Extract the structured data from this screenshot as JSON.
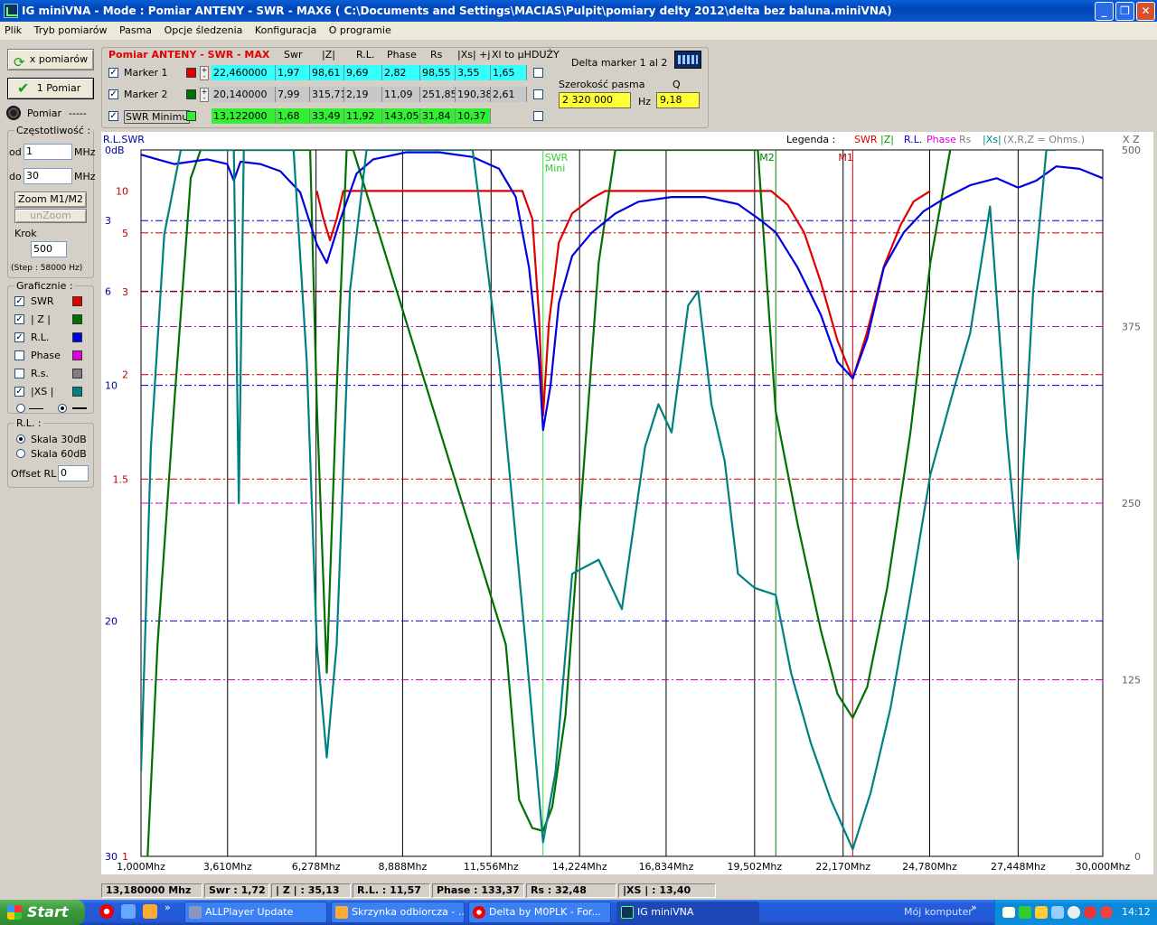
{
  "window": {
    "title": "IG miniVNA - Mode : Pomiar ANTENY - SWR     - MAX6 ( C:\\Documents and Settings\\MACIAS\\Pulpit\\pomiary delty 2012\\delta bez baluna.miniVNA)",
    "buttons": [
      "minimize",
      "maximize",
      "close"
    ]
  },
  "menu": [
    "Plik",
    "Tryb pomiarów",
    "Pasma",
    "Opcje śledzenia",
    "Konfiguracja",
    "O programie"
  ],
  "left": {
    "x_pomiarow": "x pomiarów",
    "one_pomiar": "1 Pomiar",
    "pomiar_label": "Pomiar",
    "pomiar_value": "-----",
    "freq_group": "Częstotliwość :",
    "od_label": "od",
    "od_value": "1",
    "do_label": "do",
    "do_value": "30",
    "mhz": "MHz",
    "zoom": "Zoom M1/M2",
    "unzoom": "unZoom",
    "krok_label": "Krok",
    "krok_value": "500",
    "step_text": "(Step : 58000 Hz)",
    "graf_group": "Graficznie :",
    "traces": [
      {
        "label": "SWR",
        "checked": true,
        "color": "#e00000"
      },
      {
        "label": "| Z |",
        "checked": true,
        "color": "#007000"
      },
      {
        "label": "R.L.",
        "checked": true,
        "color": "#0000e0"
      },
      {
        "label": "Phase",
        "checked": false,
        "color": "#e000e0"
      },
      {
        "label": "R.s.",
        "checked": false,
        "color": "#808080"
      },
      {
        "label": "|XS |",
        "checked": true,
        "color": "#008080"
      }
    ],
    "rl_group": "R.L. :",
    "skala30": "Skala 30dB",
    "skala60": "Skala 60dB",
    "offset_label": "Offset RL",
    "offset_value": "0"
  },
  "markers": {
    "title": "Pomiar ANTENY - SWR    - MAX",
    "headers": [
      "Swr",
      "|Z|",
      "R.L.",
      "Phase",
      "Rs",
      "|Xs| +j",
      "Xl to µH",
      "DUŻY"
    ],
    "rows": [
      {
        "name": "Marker 1",
        "color": "#e00000",
        "bg": "#33ffff",
        "values": [
          "22,460000",
          "1,97",
          "98,61",
          "9,69",
          "2,82",
          "98,55",
          "3,55",
          "1,65"
        ]
      },
      {
        "name": "Marker 2",
        "color": "#007000",
        "bg": "#c8c8c8",
        "values": [
          "20,140000",
          "7,99",
          "315,71",
          "2,19",
          "11,09",
          "251,85",
          "190,38",
          "2,61"
        ]
      },
      {
        "name": "SWR Minimu",
        "color": "#33ee33",
        "bg": "#33ee33",
        "values": [
          "13,122000",
          "1,68",
          "33,49",
          "11,92",
          "143,05",
          "31,84",
          "10,37"
        ]
      }
    ],
    "delta_label": "Delta marker 1 al 2",
    "bandwidth_label": "Szerokość pasma",
    "q_label": "Q",
    "bandwidth_value": "2 320 000",
    "hz": "Hz",
    "q_value": "9,18"
  },
  "chart": {
    "legend_label": "Legenda :",
    "legend_items": [
      {
        "label": "SWR",
        "color": "#e00000"
      },
      {
        "label": "|Z|",
        "color": "#00a000"
      },
      {
        "label": "R.L.",
        "color": "#0000e0"
      },
      {
        "label": "Phase",
        "color": "#e000e0"
      },
      {
        "label": "Rs",
        "color": "#808080"
      },
      {
        "label": "|Xs|",
        "color": "#008080"
      },
      {
        "label": "(X,R,Z = Ohms.)",
        "color": "#808080"
      }
    ],
    "corner_left": "R.L.SWR",
    "corner_right": "X  Z",
    "marker_labels": {
      "swr": "SWR",
      "swr2": "Mini",
      "m2": "M2",
      "m1": "M1"
    },
    "x_labels": [
      "1,000Mhz",
      "3,610Mhz",
      "6,278Mhz",
      "8,888Mhz",
      "11,556Mhz",
      "14,224Mhz",
      "16,834Mhz",
      "19,502Mhz",
      "22,170Mhz",
      "24,780Mhz",
      "27,448Mhz",
      "30,000Mhz"
    ],
    "rl_labels": [
      "0dB",
      "3",
      "6",
      "10",
      "20",
      "30"
    ],
    "swr_labels": [
      "10",
      "5",
      "3",
      "2",
      "1.5",
      "1"
    ],
    "z_labels": [
      "500",
      "375",
      "250",
      "125",
      "0"
    ]
  },
  "chart_data": {
    "type": "line",
    "xlabel": "",
    "ylabel": "",
    "xlim_mhz": [
      1.0,
      30.0
    ],
    "x_ticks_mhz": [
      1.0,
      3.61,
      6.278,
      8.888,
      11.556,
      14.224,
      16.834,
      19.502,
      22.17,
      24.78,
      27.448,
      30.0
    ],
    "swr_axis": [
      1,
      10
    ],
    "rl_axis_db": [
      0,
      30
    ],
    "z_axis_ohm": [
      0,
      500
    ],
    "markers_mhz": {
      "SWR Mini": 13.122,
      "M2": 20.14,
      "M1": 22.46
    },
    "series": [
      {
        "name": "SWR",
        "color": "#e00000",
        "axis": "swr",
        "x": [
          6.3,
          6.5,
          6.7,
          6.9,
          7.1,
          12.5,
          12.8,
          13.0,
          13.122,
          13.3,
          13.6,
          14.0,
          14.6,
          15.0,
          20.0,
          20.5,
          21.0,
          21.5,
          22.0,
          22.46,
          22.9,
          23.4,
          23.9,
          24.3,
          24.8
        ],
        "y": [
          10,
          6,
          4.6,
          6,
          10,
          10,
          6,
          2.6,
          1.75,
          2.5,
          4.5,
          6.5,
          8.5,
          10,
          10,
          7.5,
          5,
          3.2,
          2.3,
          1.97,
          2.4,
          3.6,
          5.5,
          8,
          10
        ]
      },
      {
        "name": "|Z|",
        "color": "#007000",
        "axis": "z",
        "x": [
          1.2,
          1.5,
          2.0,
          2.5,
          2.8,
          6.1,
          6.3,
          6.6,
          6.9,
          7.2,
          7.4,
          12.0,
          12.4,
          12.8,
          13.122,
          13.4,
          13.8,
          14.3,
          14.8,
          15.3,
          19.6,
          20.14,
          20.8,
          21.5,
          22.0,
          22.46,
          22.9,
          23.5,
          24.2,
          24.8,
          25.4
        ],
        "y": [
          0,
          150,
          320,
          480,
          500,
          500,
          320,
          130,
          330,
          500,
          500,
          150,
          40,
          20,
          18,
          35,
          100,
          260,
          420,
          500,
          500,
          315,
          235,
          160,
          115,
          98,
          120,
          190,
          300,
          420,
          500
        ]
      },
      {
        "name": "R.L.",
        "color": "#0000e0",
        "axis": "rl",
        "x": [
          1.0,
          1.5,
          2.0,
          3.0,
          3.6,
          3.8,
          4.0,
          4.6,
          5.2,
          5.8,
          6.3,
          6.6,
          7.0,
          7.5,
          8.0,
          9.0,
          10.0,
          11.0,
          11.8,
          12.3,
          12.7,
          13.0,
          13.122,
          13.35,
          13.6,
          14.0,
          14.6,
          15.3,
          16.0,
          17.0,
          18.0,
          19.0,
          19.7,
          20.14,
          20.8,
          21.5,
          22.0,
          22.46,
          22.9,
          23.4,
          24.0,
          24.6,
          25.3,
          26.0,
          26.8,
          27.448,
          28.0,
          28.6,
          29.3,
          30.0
        ],
        "y": [
          0.2,
          0.4,
          0.6,
          0.4,
          0.6,
          1.3,
          0.5,
          0.6,
          0.9,
          1.8,
          4.0,
          4.8,
          3.0,
          1.0,
          0.4,
          0.1,
          0.1,
          0.3,
          0.8,
          2.0,
          5.0,
          9.0,
          11.9,
          10.0,
          6.5,
          4.5,
          3.5,
          2.7,
          2.2,
          2.0,
          2.0,
          2.3,
          3.0,
          3.5,
          5.0,
          7.0,
          9.0,
          9.7,
          8.0,
          5.0,
          3.5,
          2.6,
          2.0,
          1.5,
          1.2,
          1.6,
          1.3,
          0.7,
          0.8,
          1.2
        ]
      },
      {
        "name": "|Xs|",
        "color": "#008080",
        "axis": "z",
        "x": [
          1.0,
          1.3,
          1.7,
          2.2,
          2.7,
          3.2,
          3.8,
          3.95,
          4.1,
          5.3,
          5.6,
          6.0,
          6.3,
          6.6,
          6.9,
          7.3,
          7.8,
          11.0,
          11.8,
          12.6,
          13.122,
          13.5,
          14.0,
          14.8,
          15.5,
          16.2,
          16.6,
          17.0,
          17.5,
          17.8,
          18.2,
          18.6,
          19.0,
          19.5,
          20.14,
          20.6,
          21.2,
          21.8,
          22.46,
          23.0,
          23.6,
          24.2,
          24.8,
          25.5,
          26.0,
          26.6,
          27.1,
          27.448,
          27.9,
          28.3,
          28.6
        ],
        "y": [
          60,
          290,
          440,
          500,
          500,
          500,
          500,
          250,
          500,
          500,
          500,
          350,
          150,
          70,
          150,
          400,
          500,
          500,
          350,
          150,
          10,
          60,
          200,
          210,
          175,
          290,
          320,
          300,
          390,
          400,
          320,
          280,
          200,
          190,
          185,
          130,
          80,
          40,
          5,
          45,
          105,
          185,
          270,
          330,
          370,
          460,
          300,
          210,
          400,
          500,
          500
        ]
      }
    ]
  },
  "status": [
    "13,180000 Mhz",
    "Swr : 1,72",
    "| Z | : 35,13",
    "R.L. : 11,57",
    "Phase : 133,37",
    "Rs : 32,48",
    "|XS | : 13,40"
  ],
  "taskbar": {
    "start": "Start",
    "tasks": [
      "ALLPlayer Update",
      "Skrzynka odbiorcza - ...",
      "Delta by M0PLK - For...",
      "IG miniVNA"
    ],
    "desktop_label": "Mój komputer",
    "clock": "14:12"
  }
}
